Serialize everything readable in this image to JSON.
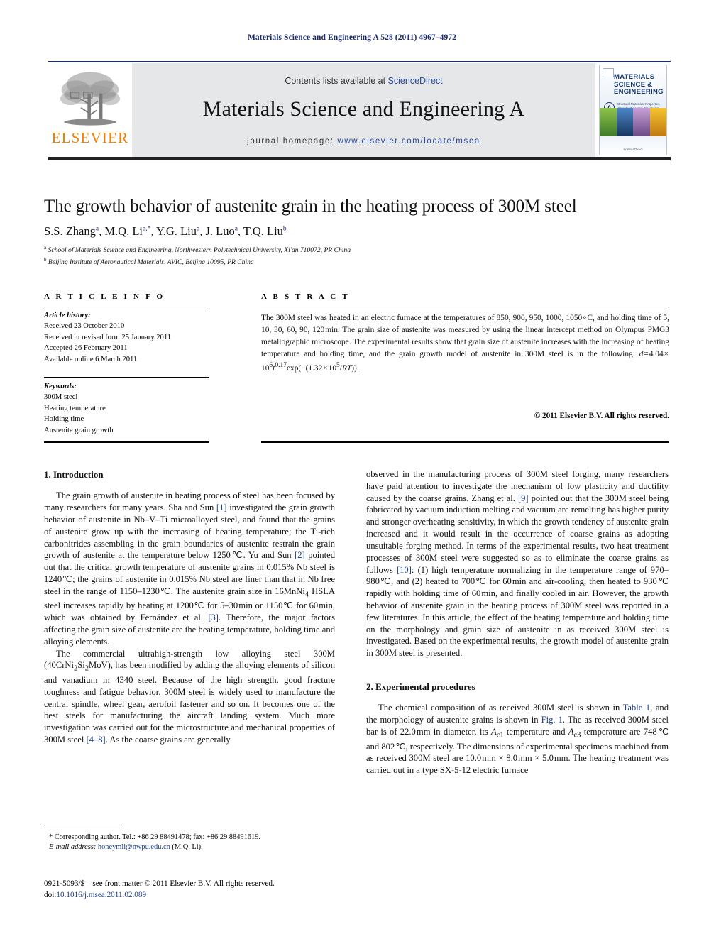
{
  "running_head": "Materials Science and Engineering A 528 (2011) 4967–4972",
  "masthead": {
    "contents_prefix": "Contents lists available at ",
    "sciencedirect": "ScienceDirect",
    "journal_title": "Materials Science and Engineering A",
    "homepage_prefix": "journal homepage:",
    "homepage_url": "www.elsevier.com/locate/msea",
    "publisher_logo_text": "ELSEVIER",
    "cover": {
      "title_line1": "MATERIALS",
      "title_line2": "SCIENCE &",
      "title_line3": "ENGINEERING",
      "section_letter": "A",
      "subtitle": "Structural Materials: Properties, Microstructure and Processing",
      "footer": "ScienceDirect"
    }
  },
  "article": {
    "title": "The growth behavior of austenite grain in the heating process of 300M steel",
    "authors_html": "S.S. Zhang<sup>a</sup>, M.Q. Li<sup>a,*</sup>, Y.G. Liu<sup>a</sup>, J. Luo<sup>a</sup>, T.Q. Liu<sup>b</sup>",
    "affiliation_a": "School of Materials Science and Engineering, Northwestern Polytechnical University, Xi'an 710072, PR China",
    "affiliation_b": "Beijing Institute of Aeronautical Materials, AVIC, Beijing 10095, PR China"
  },
  "info": {
    "heading": "A R T I C L E   I N F O",
    "history_label": "Article history:",
    "history": [
      "Received 23 October 2010",
      "Received in revised form 25 January 2011",
      "Accepted 26 February 2011",
      "Available online 6 March 2011"
    ],
    "keywords_label": "Keywords:",
    "keywords": [
      "300M steel",
      "Heating temperature",
      "Holding time",
      "Austenite grain growth"
    ]
  },
  "abstract": {
    "heading": "A B S T R A C T",
    "text_html": "The 300M steel was heated in an electric furnace at the temperatures of 850, 900, 950, 1000, 1050<span class=\"deg\">&#8728;</span>C, and holding time of 5, 10, 30, 60, 90, 120&#8202;min. The grain size of austenite was measured by using the linear intercept method on Olympus PMG3 metallographic microscope. The experimental results show that grain size of austenite increases with the increasing of heating temperature and holding time, and the grain growth model of austenite in 300M steel is in the following: <i>d</i>&#8202;=&#8202;4.04&#8202;&#215;&#8202;10<sup>6</sup><i>t</i><sup>0.17</sup>exp(&#8722;(1.32&#8202;&#215;&#8202;10<sup>5</sup>/<i>RT</i>)).",
    "copyright": "© 2011 Elsevier B.V. All rights reserved."
  },
  "sections": {
    "introduction_heading": "1.  Introduction",
    "experimental_heading": "2.  Experimental procedures"
  },
  "body": {
    "intro_p1_html": "The grain growth of austenite in heating process of steel has been focused by many researchers for many years. Sha and Sun <span class=\"ref\">[1]</span> investigated the grain growth behavior of austenite in Nb&#8211;V&#8211;Ti microalloyed steel, and found that the grains of austenite grow up with the increasing of heating temperature; the Ti-rich carbonitrides assembling in the grain boundaries of austenite restrain the grain growth of austenite at the temperature below 1250&#8202;&#8451;. Yu and Sun <span class=\"ref\">[2]</span> pointed out that the critical growth temperature of austenite grains in 0.015% Nb steel is 1240&#8451;; the grains of austenite in 0.015% Nb steel are finer than that in Nb free steel in the range of 1150&#8211;1230&#8451;. The austenite grain size in 16MnNi<sub>4</sub> HSLA steel increases rapidly by heating at 1200&#8451; for 5&#8211;30&#8202;min or 1150&#8451; for 60&#8202;min, which was obtained by Fern&#225;ndez et al. <span class=\"ref\">[3]</span>. Therefore, the major factors affecting the grain size of austenite are the heating temperature, holding time and alloying elements.",
    "intro_p2_html": "The commercial ultrahigh-strength low alloying steel 300M (40CrNi<sub>2</sub>Si<sub>2</sub>MoV), has been modified by adding the alloying elements of silicon and vanadium in 4340 steel. Because of the high strength, good fracture toughness and fatigue behavior, 300M steel is widely used to manufacture the central spindle, wheel gear, aerofoil fastener and so on. It becomes one of the best steels for manufacturing the aircraft landing system. Much more investigation was carried out for the microstructure and mechanical properties of 300M steel <span class=\"ref\">[4&#8211;8]</span>. As the coarse grains are generally",
    "intro_p2_cont_html": "observed in the manufacturing process of 300M steel forging, many researchers have paid attention to investigate the mechanism of low plasticity and ductility caused by the coarse grains. Zhang et al. <span class=\"ref\">[9]</span> pointed out that the 300M steel being fabricated by vacuum induction melting and vacuum arc remelting has higher purity and stronger overheating sensitivity, in which the growth tendency of austenite grain increased and it would result in the occurrence of coarse grains as adopting unsuitable forging method. In terms of the experimental results, two heat treatment processes of 300M steel were suggested so as to eliminate the coarse grains as follows <span class=\"ref\">[10]</span>: (1) high temperature normalizing in the temperature range of 970&#8211;980&#8451;, and (2) heated to 700&#8451; for 60&#8202;min and air-cooling, then heated to 930&#8202;&#8451; rapidly with holding time of 60&#8202;min, and finally cooled in air. However, the growth behavior of austenite grain in the heating process of 300M steel was reported in a few literatures. In this article, the effect of the heating temperature and holding time on the morphology and grain size of austenite in as received 300M steel is investigated. Based on the experimental results, the growth model of austenite grain in 300M steel is presented.",
    "exp_p1_html": "The chemical composition of as received 300M steel is shown in <span class=\"ref\">Table 1</span>, and the morphology of austenite grains is shown in <span class=\"ref\">Fig. 1</span>. The as received 300M steel bar is of 22.0&#8202;mm in diameter, its <i>A</i><sub>c1</sub> temperature and <i>A</i><sub>c3</sub> temperature are 748&#8202;&#8451; and 802&#8202;&#8451;, respectively. The dimensions of experimental specimens machined from as received 300M steel are 10.0&#8202;mm &#215; 8.0&#8202;mm &#215; 5.0&#8202;mm. The heating treatment was carried out in a type SX-5-12 electric furnace"
  },
  "footnote": {
    "corresponding_html": "* Corresponding author. Tel.: +86 29 88491478; fax: +86 29 88491619.",
    "email_label": "E-mail address:",
    "email": "honeymli@nwpu.edu.cn",
    "email_suffix": "(M.Q. Li).",
    "imprint_line1": "0921-5093/$ – see front matter © 2011 Elsevier B.V. All rights reserved.",
    "doi_label": "doi:",
    "doi_value": "10.1016/j.msea.2011.02.089"
  },
  "colors": {
    "link": "#1f3f87",
    "running_head": "#1a2a6c",
    "elsevier_orange": "#F08000",
    "masthead_band": "#e6e7e8"
  }
}
